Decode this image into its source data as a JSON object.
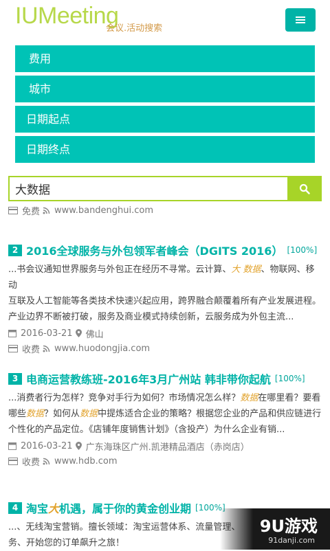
{
  "header": {
    "logo_main": "IUMeeting",
    "logo_sub": "会议.活动搜索"
  },
  "filters": [
    {
      "label": "费用"
    },
    {
      "label": "城市"
    },
    {
      "label": "日期起点"
    },
    {
      "label": "日期终点"
    }
  ],
  "search": {
    "value": "大数据"
  },
  "results": [
    {
      "fee": "免费",
      "url": "www.bandenghui.com"
    },
    {
      "number": "2",
      "title": "2016全球服务与外包领军者峰会（DGITS 2016）",
      "match": "[100%]",
      "date": "2016-03-21",
      "location": "佛山",
      "fee": "收费",
      "url": "www.huodongjia.com"
    },
    {
      "number": "3",
      "title": "电商运营教练班-2016年3月广州站 韩非带你起航",
      "match": "[100%]",
      "date": "2016-03-21",
      "location": "广东海珠区广州.凯港精品酒店（赤岗店）",
      "fee": "收费",
      "url": "www.hdb.com"
    },
    {
      "number": "4",
      "title_a": "淘宝",
      "title_hl": "大",
      "title_b": "机遇，属于你的黄金创业期",
      "match": "[100%]"
    }
  ],
  "desc2": {
    "l1a": "...书会议通知世界服务与外包正在经历不寻常。云计算、",
    "l1hl": "大 数据",
    "l1b": "、物联网、移动",
    "l2": "互联及人工智能等各类技术快速兴起应用，跨界融合颠覆着所有产业发展进程。",
    "l3": "产业边界不断被打破，服务及商业模式持续创新，云服务成为外包主流..."
  },
  "desc3": {
    "l1a": "...消费者行为怎样？竞争对手行为如何？市场情况怎么样？",
    "l1hl": "数据",
    "l1b": "在哪里看？要看",
    "l2a": "哪些",
    "l2hl": "数据",
    "l2b": "？如何从",
    "l2hl2": "数据",
    "l2c": "中提炼适合企业的策略？根据您企业的产品和供应链进行",
    "l3": "个性化的产品定位。《店铺年度销售计划》（含投产）为什么企业有销..."
  },
  "desc4": {
    "l1": "...、无线淘宝营销。擅长领域：淘宝运营体系、流量管理、",
    "l2": "务、开始您的订单飙升之旅！"
  },
  "watermark": {
    "main": "9U游戏",
    "sub": "91danji.com"
  }
}
